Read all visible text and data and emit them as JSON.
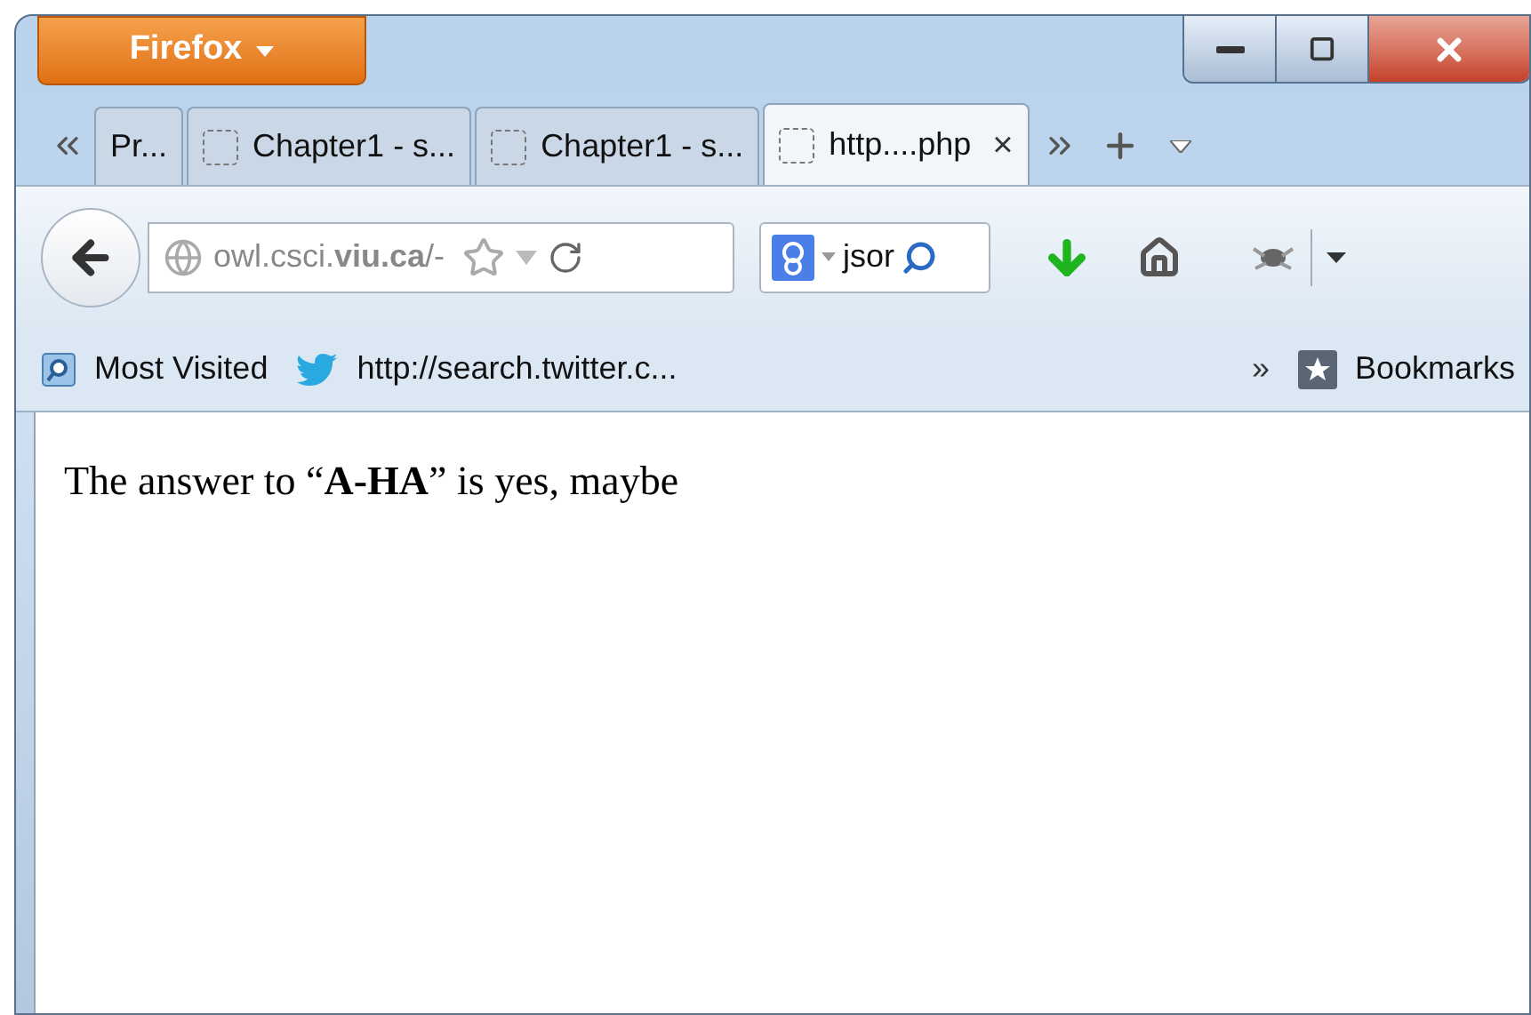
{
  "app_button": {
    "label": "Firefox"
  },
  "tabs": [
    {
      "title": "Pr...",
      "selected": false,
      "has_favicon": false
    },
    {
      "title": "Chapter1 - s...",
      "selected": false,
      "has_favicon": true
    },
    {
      "title": "Chapter1 - s...",
      "selected": false,
      "has_favicon": true
    },
    {
      "title": "http....php",
      "selected": true,
      "has_favicon": true
    }
  ],
  "close_tab": "×",
  "address": {
    "value": "owl.csci.**viu.ca**/-"
  },
  "search": {
    "value": "jsor"
  },
  "bookmarks": [
    {
      "kind": "folder",
      "label": "Most Visited"
    },
    {
      "kind": "twitter",
      "label": "http://search.twitter.c..."
    }
  ],
  "overflow": "»",
  "bookmarks_menu": "Bookmarks",
  "page_text": "The answer to “**A-HA**” is yes, maybe"
}
